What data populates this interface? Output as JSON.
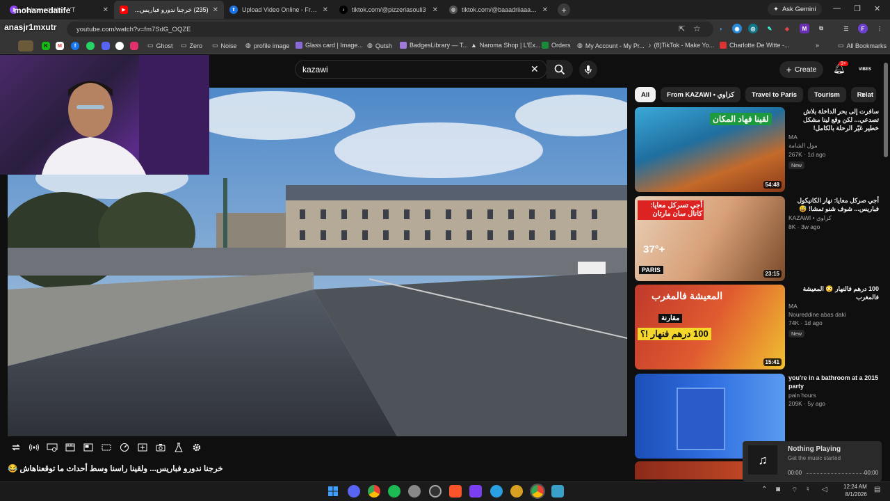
{
  "tabs": [
    {
      "label": "mohamedatife - YT",
      "icon": "twitch-icon",
      "active": false
    },
    {
      "label": "(235) خرجنا ندورو فباريس...",
      "icon": "youtube-icon",
      "active": true
    },
    {
      "label": "Upload Video Online - Free Vid",
      "icon": "upload-icon",
      "active": false
    },
    {
      "label": "tiktok.com/@pizzeriasouli3",
      "icon": "tiktok-icon",
      "active": false
    },
    {
      "label": "tiktok.com/@baaadriiaaa/video",
      "icon": "globe-icon",
      "active": false
    }
  ],
  "overlay": {
    "streamer_name": "mohamedatife",
    "chat_user": "anasjr1mxutr"
  },
  "gemini_label": "Ask Gemini",
  "url": "youtube.com/watch?v=fm7SdG_OQZE",
  "bookmarks": [
    "Ghost",
    "Zero",
    "Noise",
    "profile image",
    "Glass card | Image...",
    "Qutsh",
    "BadgesLibrary — T...",
    "Naroma Shop | L'Ex...",
    "Orders",
    "My Account - My Pr...",
    "(8)TikTok - Make Yo...",
    "Charlotte De Witte -...",
    "All Bookmarks"
  ],
  "youtube": {
    "search_value": "kazawi",
    "create_label": "Create",
    "notif_count": "9+",
    "avatar_text": "VIBES",
    "chips": [
      "All",
      "From KAZAWI • كزاوي",
      "Travel to Paris",
      "Tourism",
      "Relat"
    ],
    "video_title": "خرجنا ندورو فباريس... ولقينا راسنا وسط أحداث ما توقعناهاش 😂",
    "recommendations": [
      {
        "title": "سافرت إلى بحر الداخلة بلاش تصدعي... لكن وقع لينا مشكل خطير غيّر الرحلة بالكامل!",
        "channel": "MA",
        "sub": "مول الشامة",
        "views": "267K",
        "age": "1d ago",
        "new": "New",
        "duration": "54:48",
        "overlay": "لقينا فهاد المكان"
      },
      {
        "title": "أجي صركل معايا: نهار الكانيكول فباريس... شوف شنو تمشا! 😅",
        "channel": "KAZAWI • كزاوي",
        "sub": "",
        "views": "8K",
        "age": "3w ago",
        "new": "",
        "duration": "23:15",
        "overlay": "أجي تسركل معايا: كانال سان مارتان"
      },
      {
        "title": "100 درهم فالنهار 😳 المعيشة فالمغرب",
        "channel": "MA",
        "sub": "Noureddine abas daki",
        "views": "74K",
        "age": "1d ago",
        "new": "New",
        "duration": "15:41",
        "overlay": "المعيشة فالمغرب"
      },
      {
        "title": "you're in a bathroom at a 2015 party",
        "channel": "pain hours",
        "sub": "",
        "views": "209K",
        "age": "5y ago",
        "new": "",
        "duration": "",
        "overlay": ""
      }
    ]
  },
  "thumb_overlays": {
    "temp": "37°+",
    "city": "PARIS",
    "compare": "مقارنة",
    "price": "100 درهم فنهار !؟"
  },
  "music": {
    "title": "Nothing Playing",
    "subtitle": "Get the music started",
    "t_start": "00:00",
    "t_end": "00:00"
  },
  "clock": {
    "time": "12:24 AM",
    "date": "8/1/2026"
  }
}
